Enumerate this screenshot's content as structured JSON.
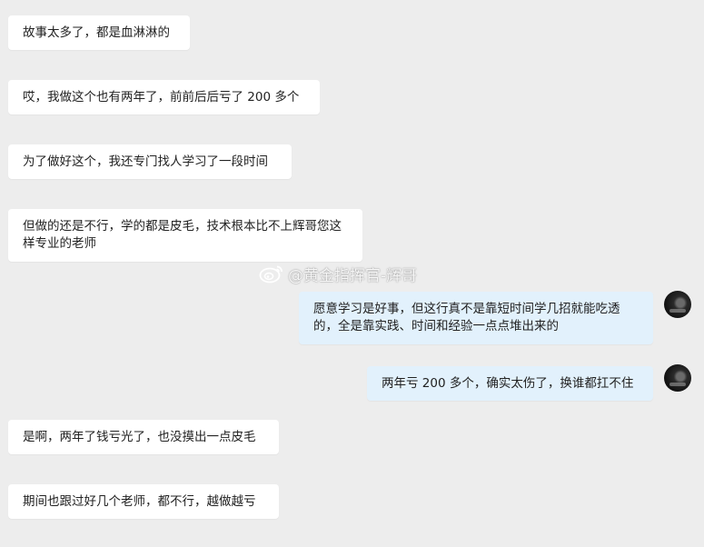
{
  "messages": [
    {
      "side": "left",
      "text": "故事太多了，都是血淋淋的"
    },
    {
      "side": "left",
      "text": "哎，我做这个也有两年了，前前后后亏了 200 多个"
    },
    {
      "side": "left",
      "text": "为了做好这个，我还专门找人学习了一段时间"
    },
    {
      "side": "left",
      "text": "但做的还是不行，学的都是皮毛，技术根本比不上辉哥您这样专业的老师"
    },
    {
      "side": "right",
      "text": "愿意学习是好事，但这行真不是靠短时间学几招就能吃透的，全是靠实践、时间和经验一点点堆出来的"
    },
    {
      "side": "right",
      "text": "两年亏 200 多个，确实太伤了，换谁都扛不住"
    },
    {
      "side": "left",
      "text": "是啊，两年了钱亏光了，也没摸出一点皮毛"
    },
    {
      "side": "left",
      "text": "期间也跟过好几个老师，都不行，越做越亏"
    }
  ],
  "watermark": {
    "text": "@黄金指挥官-辉哥",
    "icon": "weibo-logo-icon"
  },
  "colors": {
    "background": "#ededed",
    "left_bubble": "#ffffff",
    "right_bubble": "#e2f1fc"
  }
}
